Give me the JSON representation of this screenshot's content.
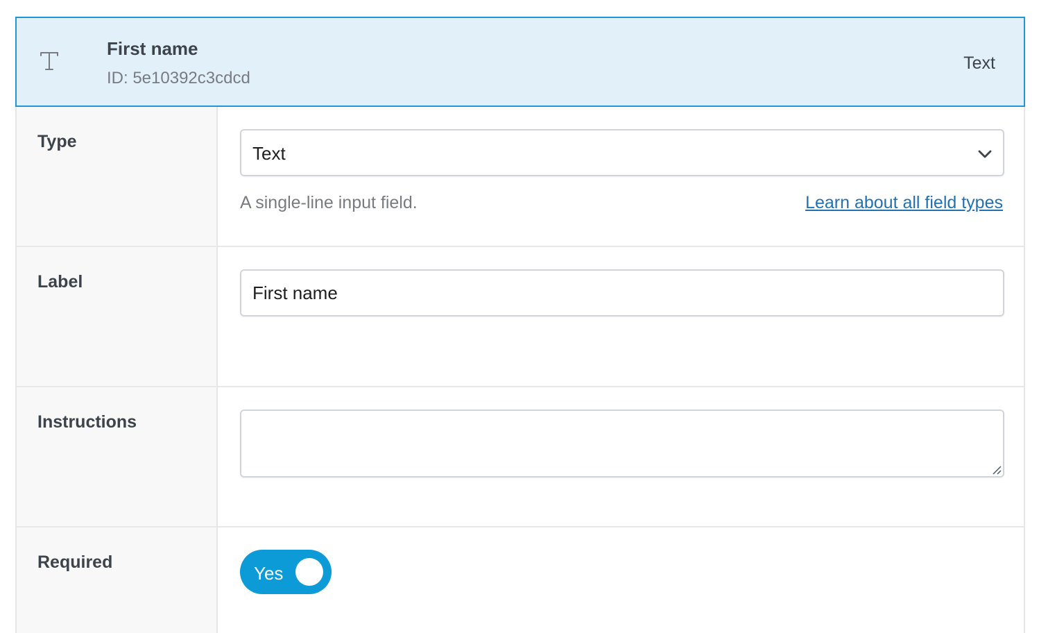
{
  "header": {
    "icon": "text-type-icon",
    "title": "First name",
    "id_text": "ID: 5e10392c3cdcd",
    "type_text": "Text"
  },
  "type_row": {
    "label": "Type",
    "selected": "Text",
    "description": "A single-line input field.",
    "link": "Learn about all field types"
  },
  "label_row": {
    "label": "Label",
    "value": "First name"
  },
  "instructions_row": {
    "label": "Instructions",
    "value": ""
  },
  "required_row": {
    "label": "Required",
    "toggle_label": "Yes",
    "toggle_on": true
  },
  "colors": {
    "header_bg": "#e2f0fa",
    "header_border": "#1f97d6",
    "toggle_on": "#0d9bd8",
    "link": "#2271b1"
  }
}
